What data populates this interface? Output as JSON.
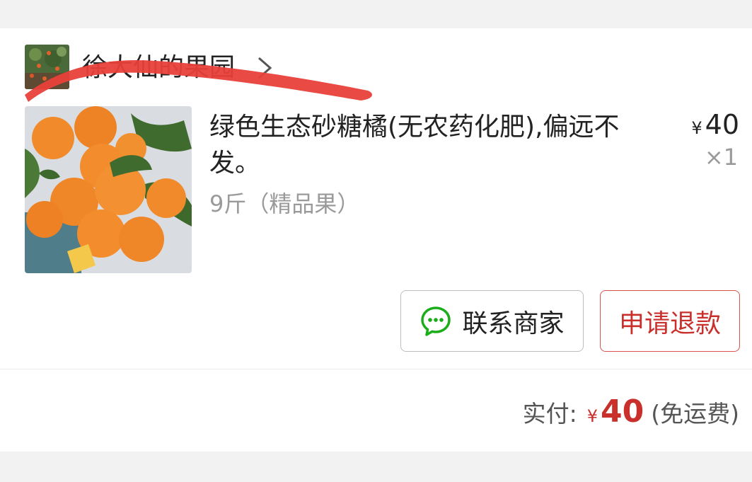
{
  "shop": {
    "name": "徐大仙的果园",
    "avatar_icon": "orchard-avatar",
    "chevron_icon": "chevron-right-icon"
  },
  "product": {
    "title": "绿色生态砂糖橘(无农药化肥),偏远不发。",
    "spec": "9斤（精品果）",
    "currency": "¥",
    "price": "40",
    "quantity": "×1",
    "image_icon": "mandarin-oranges-photo"
  },
  "actions": {
    "contact_label": "联系商家",
    "contact_icon": "chat-bubble-icon",
    "refund_label": "申请退款"
  },
  "payment": {
    "label": "实付:",
    "currency": "¥",
    "amount": "40",
    "note": "(免运费)"
  },
  "colors": {
    "accent_red": "#c9302c",
    "chat_green": "#1aad19",
    "redaction_red": "#e8403a"
  }
}
